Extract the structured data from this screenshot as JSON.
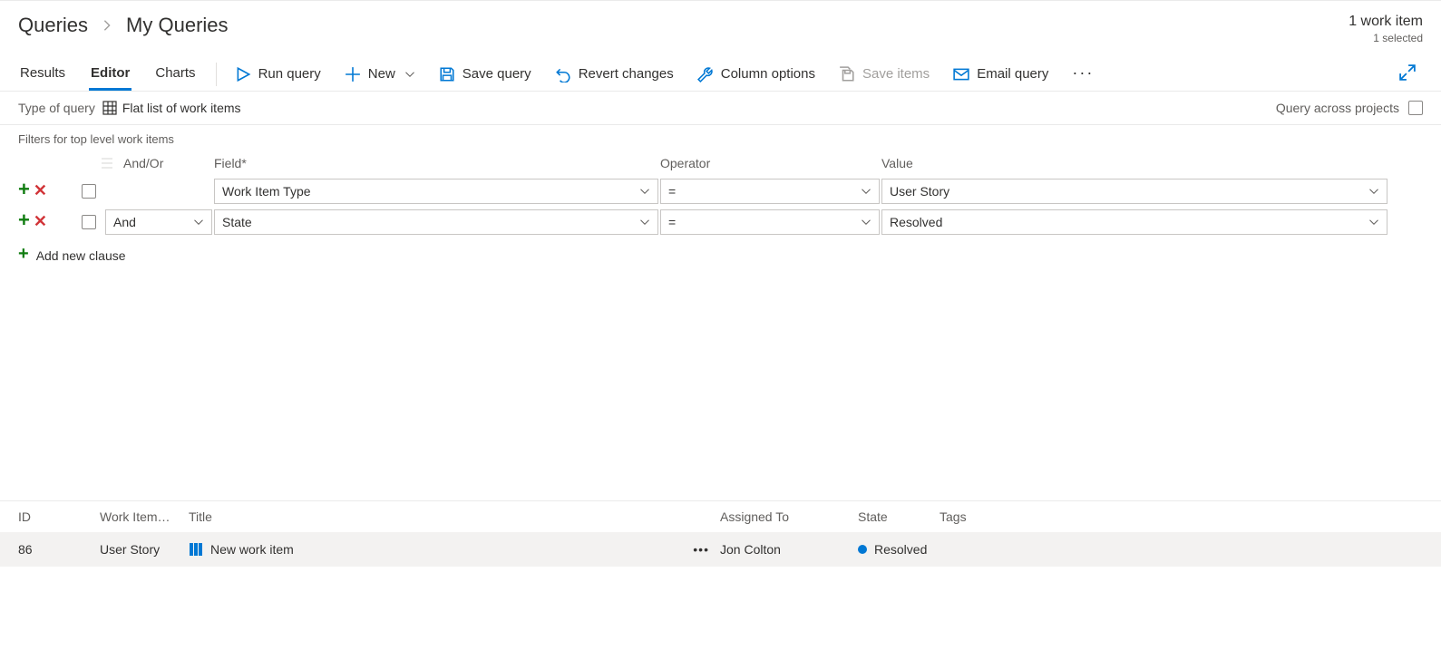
{
  "breadcrumb": {
    "root": "Queries",
    "current": "My Queries"
  },
  "work_count": {
    "main": "1 work item",
    "sub": "1 selected"
  },
  "tabs": {
    "results": "Results",
    "editor": "Editor",
    "charts": "Charts"
  },
  "toolbar": {
    "run": "Run query",
    "new": "New",
    "save": "Save query",
    "revert": "Revert changes",
    "columns": "Column options",
    "save_items": "Save items",
    "email": "Email query"
  },
  "query_type": {
    "label": "Type of query",
    "value": "Flat list of work items",
    "across_label": "Query across projects"
  },
  "filters": {
    "title": "Filters for top level work items",
    "headers": {
      "andor": "And/Or",
      "field": "Field*",
      "operator": "Operator",
      "value": "Value"
    },
    "rows": [
      {
        "andor": "",
        "field": "Work Item Type",
        "op": "=",
        "value": "User Story"
      },
      {
        "andor": "And",
        "field": "State",
        "op": "=",
        "value": "Resolved"
      }
    ],
    "add_clause": "Add new clause"
  },
  "results": {
    "headers": {
      "id": "ID",
      "type": "Work Item…",
      "title": "Title",
      "assigned": "Assigned To",
      "state": "State",
      "tags": "Tags"
    },
    "row": {
      "id": "86",
      "type": "User Story",
      "title": "New work item",
      "assigned": "Jon Colton",
      "state": "Resolved"
    }
  }
}
